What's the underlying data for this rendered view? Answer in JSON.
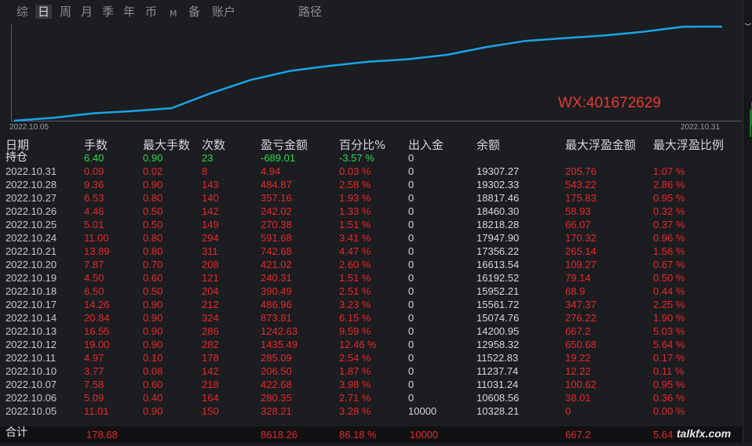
{
  "tabs": [
    {
      "label": "综",
      "active": false
    },
    {
      "label": "日",
      "active": true
    },
    {
      "label": "周",
      "active": false
    },
    {
      "label": "月",
      "active": false
    },
    {
      "label": "季",
      "active": false
    },
    {
      "label": "年",
      "active": false
    },
    {
      "label": "币",
      "active": false
    },
    {
      "label": "M",
      "active": false
    },
    {
      "label": "备",
      "active": false
    },
    {
      "label": "账户",
      "active": false
    },
    {
      "label": "路径",
      "active": false
    }
  ],
  "chart_data": {
    "type": "line",
    "x_start_label": "2022.10.05",
    "x_end_label": "2022.10.31",
    "annotation": "WX:401672629",
    "line_color": "#1aa3e8",
    "series": [
      {
        "values": [
          10328.21,
          10608.56,
          11031.24,
          11237.74,
          11522.83,
          12958.32,
          14200.95,
          15074.76,
          15561.72,
          15952.21,
          16192.52,
          16613.54,
          17356.22,
          17947.9,
          18218.28,
          18460.3,
          18817.46,
          19302.33,
          19307.27
        ]
      }
    ]
  },
  "table": {
    "headers": [
      "日期",
      "手数",
      "最大手数",
      "次数",
      "盈亏金额",
      "百分比%",
      "出入金",
      "余额",
      "最大浮盈金额",
      "最大浮盈比例"
    ],
    "position_row": {
      "label": "持仓",
      "lots": "6.40",
      "max_lots": "0.90",
      "count": "23",
      "pnl": "-689.01",
      "pct": "-3.57 %",
      "inout": "0"
    },
    "rows": [
      [
        "2022.10.31",
        "0.09",
        "0.02",
        "8",
        "4.94",
        "0.03 %",
        "0",
        "19307.27",
        "205.76",
        "1.07 %"
      ],
      [
        "2022.10.28",
        "9.36",
        "0.90",
        "143",
        "484.87",
        "2.58 %",
        "0",
        "19302.33",
        "543.22",
        "2.86 %"
      ],
      [
        "2022.10.27",
        "6.53",
        "0.80",
        "140",
        "357.16",
        "1.93 %",
        "0",
        "18817.46",
        "175.83",
        "0.95 %"
      ],
      [
        "2022.10.26",
        "4.46",
        "0.50",
        "142",
        "242.02",
        "1.33 %",
        "0",
        "18460.30",
        "58.93",
        "0.32 %"
      ],
      [
        "2022.10.25",
        "5.01",
        "0.50",
        "149",
        "270.38",
        "1.51 %",
        "0",
        "18218.28",
        "66.07",
        "0.37 %"
      ],
      [
        "2022.10.24",
        "11.00",
        "0.80",
        "294",
        "591.68",
        "3.41 %",
        "0",
        "17947.90",
        "170.32",
        "0.96 %"
      ],
      [
        "2022.10.21",
        "13.89",
        "0.80",
        "311",
        "742.68",
        "4.47 %",
        "0",
        "17356.22",
        "265.14",
        "1.56 %"
      ],
      [
        "2022.10.20",
        "7.87",
        "0.70",
        "208",
        "421.02",
        "2.60 %",
        "0",
        "16613.54",
        "109.27",
        "0.67 %"
      ],
      [
        "2022.10.19",
        "4.50",
        "0.60",
        "121",
        "240.31",
        "1.51 %",
        "0",
        "16192.52",
        "79.14",
        "0.50 %"
      ],
      [
        "2022.10.18",
        "6.50",
        "0.50",
        "204",
        "390.49",
        "2.51 %",
        "0",
        "15952.21",
        "68.9",
        "0.44 %"
      ],
      [
        "2022.10.17",
        "14.26",
        "0.90",
        "212",
        "486.96",
        "3.23 %",
        "0",
        "15561.72",
        "347.37",
        "2.25 %"
      ],
      [
        "2022.10.14",
        "20.84",
        "0.90",
        "324",
        "873.81",
        "6.15 %",
        "0",
        "15074.76",
        "276.22",
        "1.90 %"
      ],
      [
        "2022.10.13",
        "16.55",
        "0.90",
        "286",
        "1242.63",
        "9.59 %",
        "0",
        "14200.95",
        "667.2",
        "5.03 %"
      ],
      [
        "2022.10.12",
        "19.00",
        "0.90",
        "282",
        "1435.49",
        "12.46 %",
        "0",
        "12958.32",
        "650.68",
        "5.64 %"
      ],
      [
        "2022.10.11",
        "4.97",
        "0.10",
        "178",
        "285.09",
        "2.54 %",
        "0",
        "11522.83",
        "19.22",
        "0.17 %"
      ],
      [
        "2022.10.10",
        "3.77",
        "0.08",
        "142",
        "206.50",
        "1.87 %",
        "0",
        "11237.74",
        "12.22",
        "0.11 %"
      ],
      [
        "2022.10.07",
        "7.58",
        "0.60",
        "218",
        "422.68",
        "3.98 %",
        "0",
        "11031.24",
        "100.62",
        "0.95 %"
      ],
      [
        "2022.10.06",
        "5.09",
        "0.40",
        "164",
        "280.35",
        "2.71 %",
        "0",
        "10608.56",
        "38.01",
        "0.36 %"
      ],
      [
        "2022.10.05",
        "11.01",
        "0.90",
        "150",
        "328.21",
        "3.28 %",
        "10000",
        "10328.21",
        "0",
        "0.00 %"
      ]
    ],
    "total": {
      "label": "合计",
      "lots": "178.68",
      "pnl": "8618.26",
      "pct": "86.18 %",
      "inout": "10000",
      "max_float": "667.2",
      "max_float_pct": "5.64"
    }
  },
  "watermark": "talkfx.com",
  "colors": {
    "positive": "#e82828",
    "negative": "#2ad94a",
    "background": "#1b1d21",
    "line": "#1aa3e8"
  }
}
